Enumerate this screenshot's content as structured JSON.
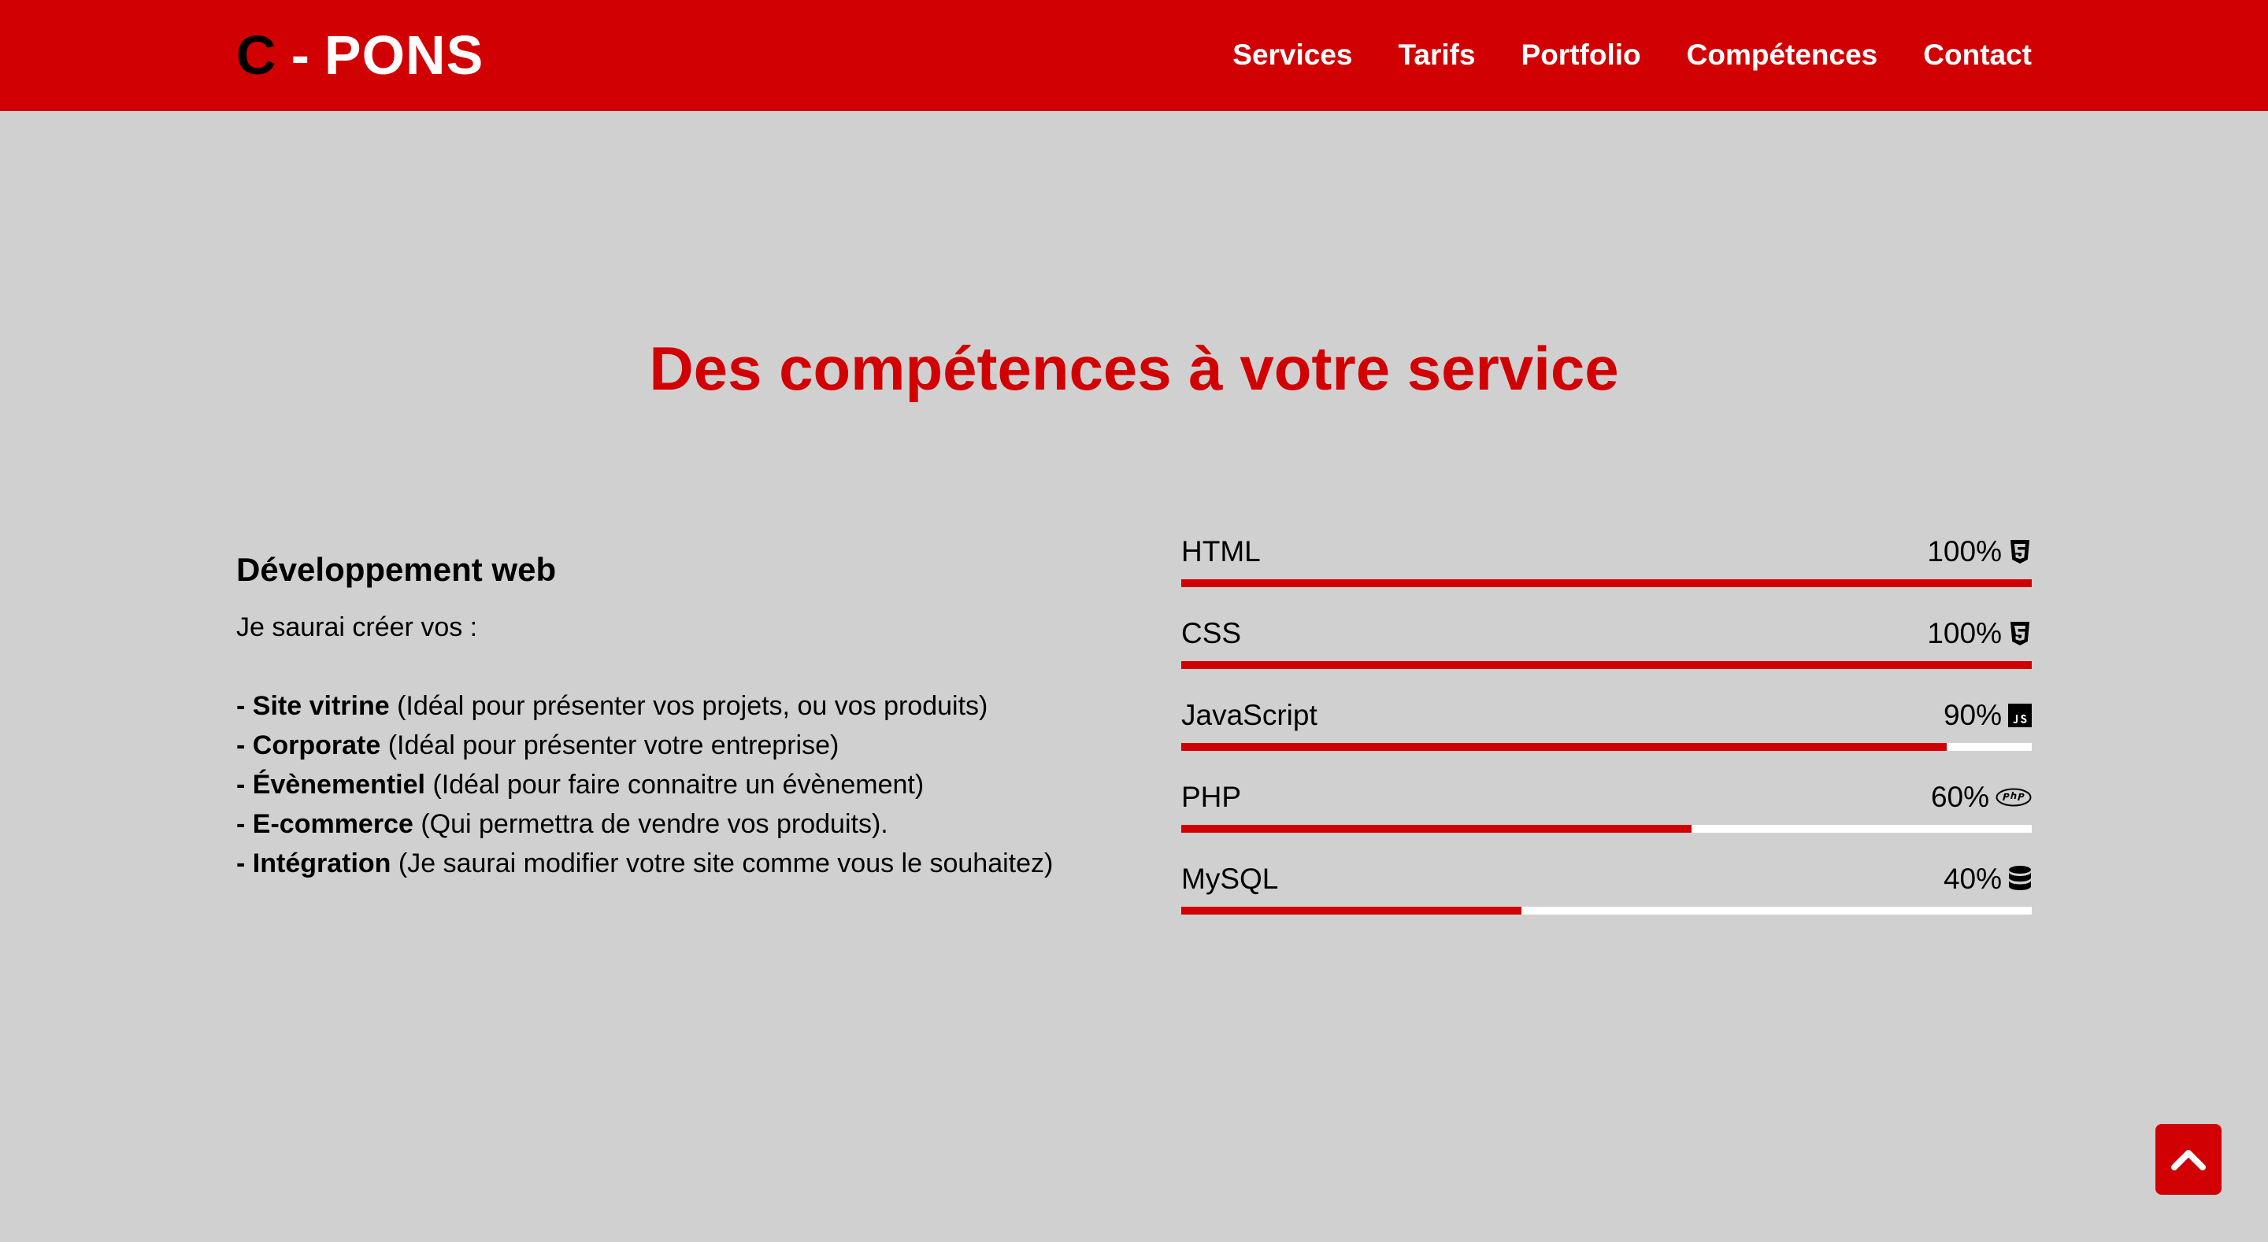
{
  "brand": {
    "c": "C",
    "dash": "-",
    "pons": "PONS"
  },
  "nav": {
    "items": [
      {
        "label": "Services"
      },
      {
        "label": "Tarifs"
      },
      {
        "label": "Portfolio"
      },
      {
        "label": "Compétences"
      },
      {
        "label": "Contact"
      }
    ]
  },
  "section": {
    "title": "Des compétences à votre service"
  },
  "web_dev": {
    "heading": "Développement web",
    "intro": "Je saurai créer vos :",
    "services": [
      {
        "prefix": "- ",
        "name": "Site vitrine",
        "desc": " (Idéal pour présenter vos projets, ou vos produits)"
      },
      {
        "prefix": "- ",
        "name": "Corporate",
        "desc": " (Idéal pour présenter votre entreprise)"
      },
      {
        "prefix": "- ",
        "name": "Évènementiel",
        "desc": " (Idéal pour faire connaitre un évènement)"
      },
      {
        "prefix": "- ",
        "name": "E-commerce",
        "desc": " (Qui permettra de vendre vos produits)."
      },
      {
        "prefix": "- ",
        "name": "Intégration",
        "desc": " (Je saurai modifier votre site comme vous le souhaitez)"
      }
    ]
  },
  "skills": [
    {
      "name": "HTML",
      "percent_label": "100%",
      "level": 100,
      "icon": "html5-icon"
    },
    {
      "name": "CSS",
      "percent_label": "100%",
      "level": 100,
      "icon": "css3-icon"
    },
    {
      "name": "JavaScript",
      "percent_label": "90%",
      "level": 90,
      "icon": "js-icon"
    },
    {
      "name": "PHP",
      "percent_label": "60%",
      "level": 60,
      "icon": "php-icon"
    },
    {
      "name": "MySQL",
      "percent_label": "40%",
      "level": 40,
      "icon": "database-icon"
    }
  ],
  "scroll_top": {
    "icon": "chevron-up-icon"
  },
  "colors": {
    "accent": "#d10003",
    "background": "#d0d0d0",
    "bar_track": "#ffffff"
  }
}
